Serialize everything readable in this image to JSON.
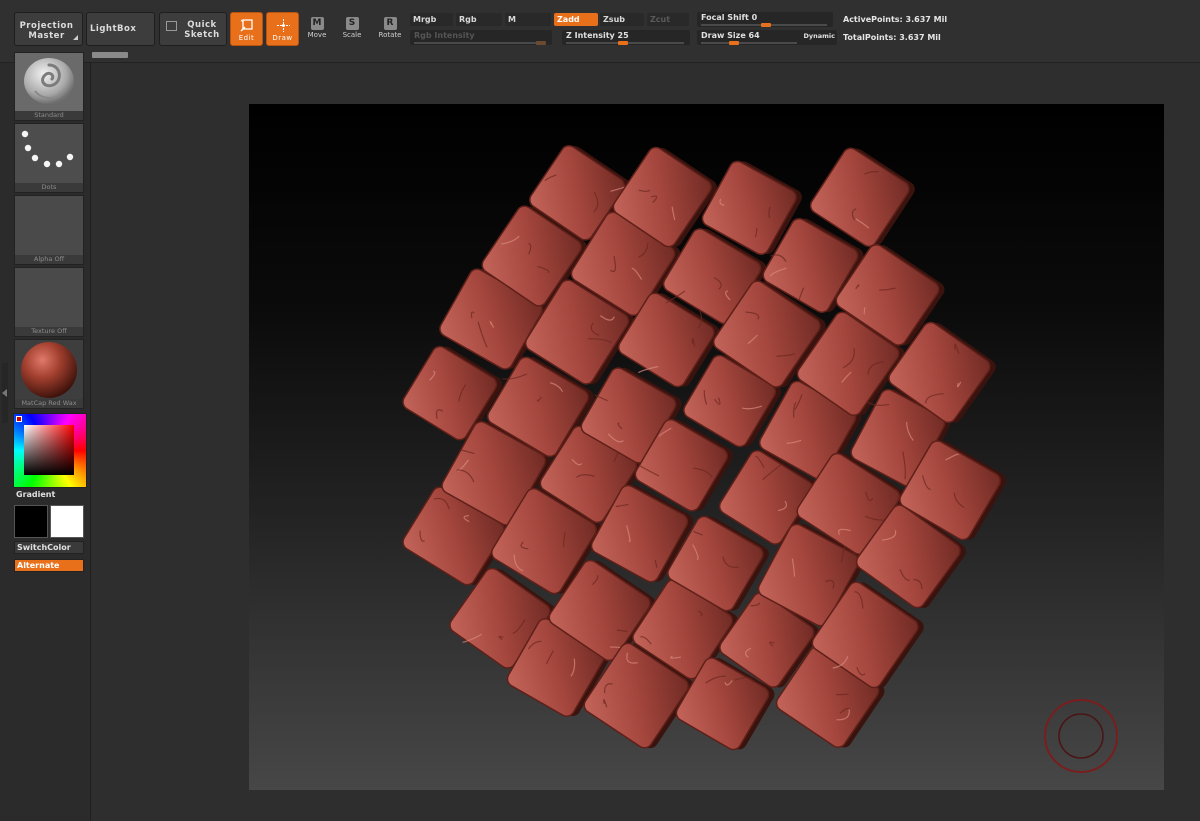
{
  "toolbar": {
    "projection_master": "Projection Master",
    "lightbox": "LightBox",
    "quick_sketch": "Quick Sketch",
    "edit": "Edit",
    "draw": "Draw",
    "move": "Move",
    "scale": "Scale",
    "rotate": "Rotate",
    "mrgb": "Mrgb",
    "rgb": "Rgb",
    "m": "M",
    "zadd": "Zadd",
    "zsub": "Zsub",
    "zcut": "Zcut",
    "rgb_intensity_label": "Rgb Intensity",
    "z_intensity_label": "Z Intensity",
    "z_intensity_value": "25",
    "focal_shift_label": "Focal Shift",
    "focal_shift_value": "0",
    "draw_size_label": "Draw Size",
    "draw_size_value": "64",
    "dynamic": "Dynamic",
    "active_points_label": "ActivePoints:",
    "active_points_value": "3.637 Mil",
    "total_points_label": "TotalPoints:",
    "total_points_value": "3.637 Mil"
  },
  "sidebar": {
    "brush_caption": "Standard",
    "stroke_caption": "Dots",
    "alpha_caption": "Alpha Off",
    "texture_caption": "Texture Off",
    "material_caption": "MatCap Red Wax",
    "gradient_label": "Gradient",
    "switch_color": "SwitchColor",
    "alternate": "Alternate"
  },
  "colors": {
    "accent": "#e8701a",
    "clay": "#a4463d",
    "background": "#2e2e2e"
  },
  "icons": [
    "edit-icon",
    "draw-icon",
    "move-icon",
    "scale-icon",
    "rotate-icon",
    "quick-sketch-icon"
  ]
}
